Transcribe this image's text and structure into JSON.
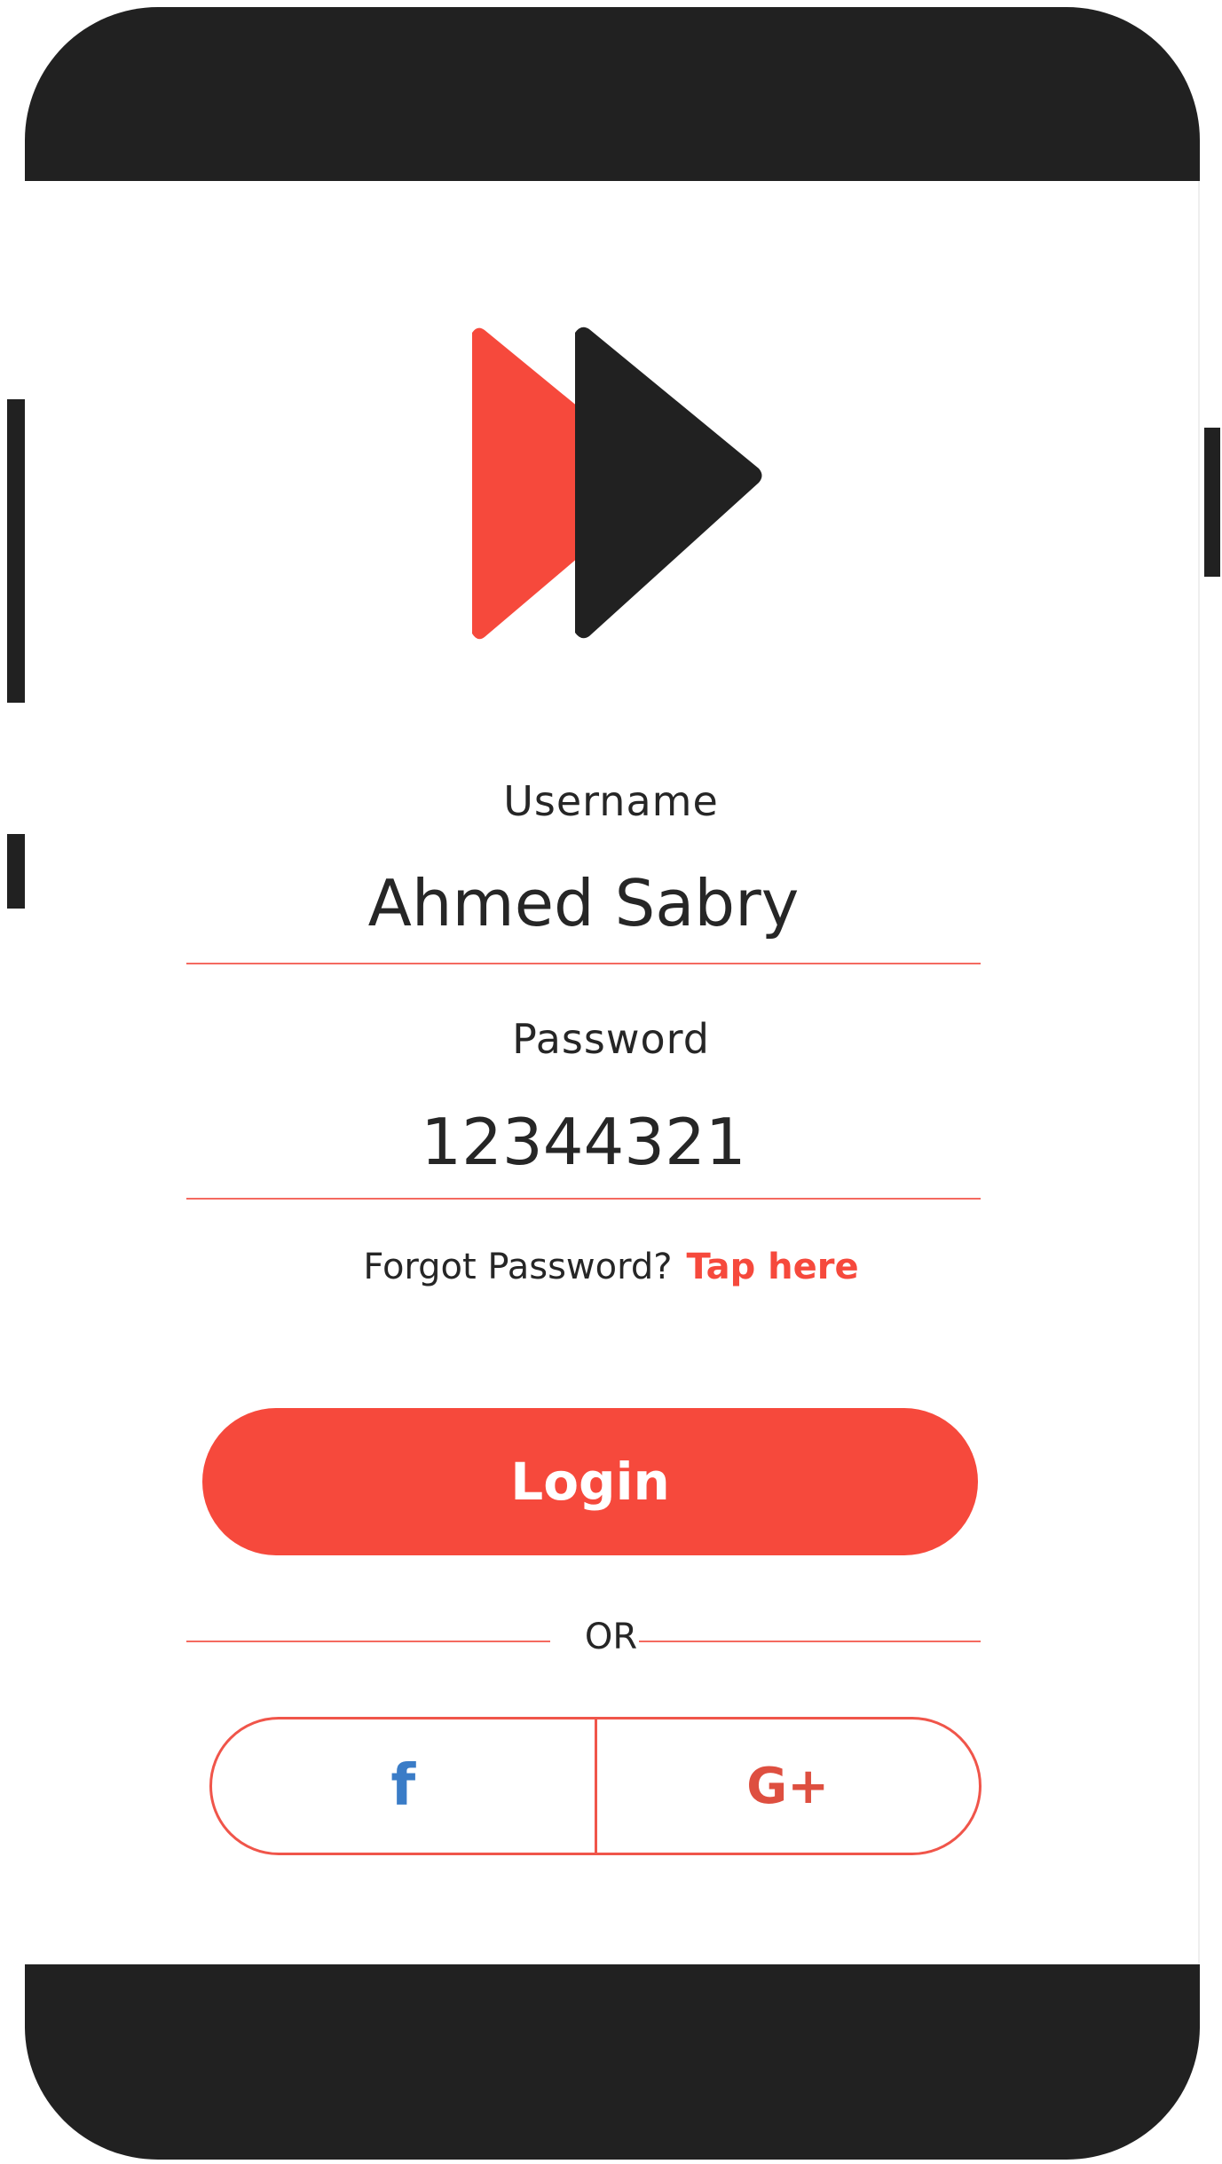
{
  "username": {
    "label": "Username",
    "value": "Ahmed Sabry"
  },
  "password": {
    "label": "Password",
    "value": "12344321"
  },
  "forgot": {
    "text": "Forgot Password?",
    "link": "Tap here"
  },
  "login_label": "Login",
  "or_label": "OR",
  "social": {
    "facebook_icon": "facebook-icon",
    "facebook_glyph": "f",
    "google_icon": "google-plus-icon",
    "google_glyph": "G+"
  },
  "colors": {
    "accent": "#f6493c",
    "dark": "#212121",
    "facebook": "#3a7cc7",
    "google": "#de4f40"
  }
}
